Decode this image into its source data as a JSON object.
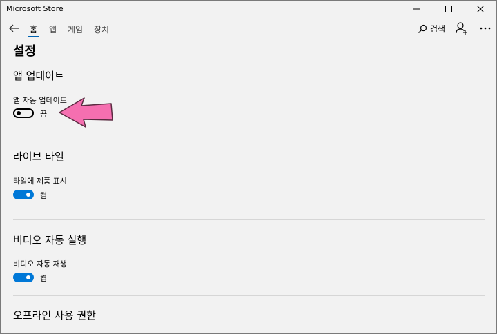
{
  "window": {
    "title": "Microsoft Store"
  },
  "nav": {
    "tabs": [
      {
        "label": "홈",
        "active": true
      },
      {
        "label": "앱"
      },
      {
        "label": "게임"
      },
      {
        "label": "장치"
      }
    ],
    "search_label": "검색"
  },
  "page": {
    "title": "설정",
    "sections": [
      {
        "title": "앱 업데이트",
        "setting_label": "앱 자동 업데이트",
        "state": "끔",
        "on": false
      },
      {
        "title": "라이브 타일",
        "setting_label": "타일에 제품 표시",
        "state": "켬",
        "on": true
      },
      {
        "title": "비디오 자동 실행",
        "setting_label": "비디오 자동 재생",
        "state": "켬",
        "on": true
      },
      {
        "title": "오프라인 사용 권한"
      }
    ]
  },
  "colors": {
    "accent": "#0078d7",
    "annotation_arrow": "#f56fb0"
  }
}
